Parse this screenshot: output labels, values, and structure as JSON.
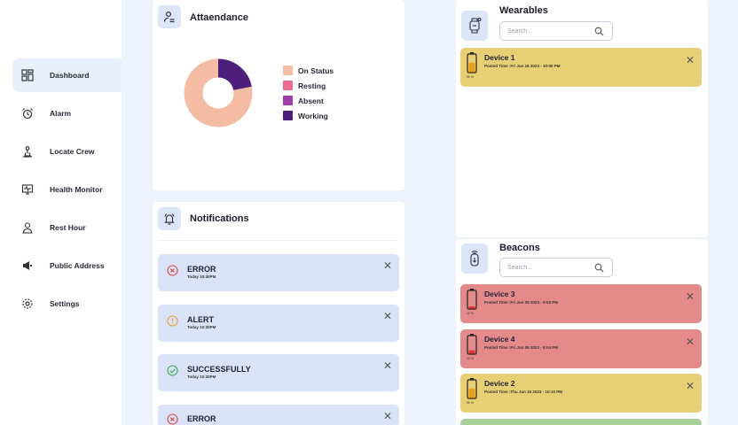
{
  "sidebar": {
    "items": [
      {
        "label": "Dashboard",
        "icon": "dashboard-icon",
        "active": true
      },
      {
        "label": "Alarm",
        "icon": "alarm-clock-icon"
      },
      {
        "label": "Locate Crew",
        "icon": "locate-pin-icon"
      },
      {
        "label": "Health Monitor",
        "icon": "health-monitor-icon"
      },
      {
        "label": "Rest Hour",
        "icon": "rest-hour-icon"
      },
      {
        "label": "Public Address",
        "icon": "megaphone-icon"
      },
      {
        "label": "Settings",
        "icon": "gear-icon"
      }
    ]
  },
  "attendance": {
    "title": "Attaendance",
    "legend": [
      {
        "label": "On Status",
        "color": "#f4bca3"
      },
      {
        "label": "Resting",
        "color": "#ec6b8f"
      },
      {
        "label": "Absent",
        "color": "#a13ea8"
      },
      {
        "label": "Working",
        "color": "#4b1f7a"
      }
    ],
    "chart": {
      "on_status_fraction": 0.78,
      "working_fraction": 0.22
    }
  },
  "notifications": {
    "title": "Notifications",
    "items": [
      {
        "type": "error",
        "title": "ERROR",
        "time": "Today 10:30PM"
      },
      {
        "type": "alert",
        "title": "ALERT",
        "time": "Today 10:30PM"
      },
      {
        "type": "success",
        "title": "SUCCESSFULLY",
        "time": "Today 10:30PM"
      },
      {
        "type": "error",
        "title": "ERROR",
        "time": ""
      }
    ]
  },
  "wearables": {
    "title": "Wearables",
    "search_placeholder": "Search...",
    "devices": [
      {
        "name": "Device 1",
        "posted": "Posted Time :Fri Jun 16 2023 - 10:00 PM",
        "battery": "55 %",
        "color": "#e6cf75",
        "level": 0.55
      }
    ]
  },
  "beacons": {
    "title": "Beacons",
    "search_placeholder": "Search...",
    "devices": [
      {
        "name": "Device 3",
        "posted": "Posted Time :Fri Jun 09 2023 - 9:04 PM",
        "battery": "12 %",
        "color": "#e48a8a",
        "level": 0.12
      },
      {
        "name": "Device 4",
        "posted": "Posted Time :Fri Jun 09 2023 - 9:04 PM",
        "battery": "20 %",
        "color": "#e48a8a",
        "level": 0.2
      },
      {
        "name": "Device 2",
        "posted": "Posted Time :Thu Jun 15 2023 - 10:10 PM",
        "battery": "55 %",
        "color": "#e6cf75",
        "level": 0.55
      }
    ]
  },
  "colors": {
    "error": "#e04848",
    "alert": "#e7a23a",
    "success": "#3fae5b",
    "battery_fill": "#e5a11a",
    "battery_fill_low": "#e03030"
  }
}
